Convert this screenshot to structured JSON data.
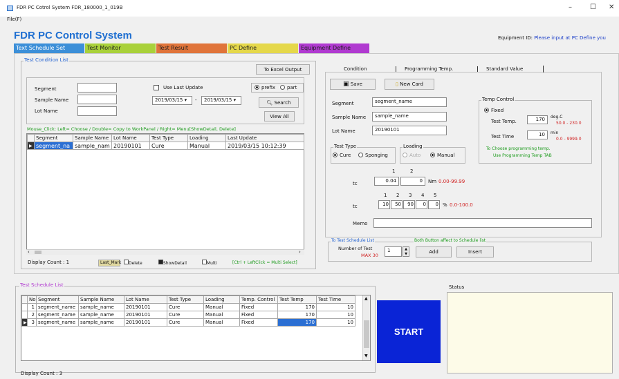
{
  "window": {
    "title": "FDR PC Cotrol System     FDR_180000_1_019B",
    "minimize": "–",
    "maximize": "☐",
    "close": "✕"
  },
  "menu": {
    "file": "File(F)"
  },
  "app": {
    "title": "FDR PC Control System"
  },
  "equipment": {
    "label": "Equipment ID:",
    "value": "Please input at PC Define you"
  },
  "top_tabs": [
    {
      "label": "Text Schedule Set",
      "color": "#3c8fd8"
    },
    {
      "label": "Test Monitor",
      "color": "#a9d13a"
    },
    {
      "label": "Test Result",
      "color": "#e0743a"
    },
    {
      "label": "PC Define",
      "color": "#e5d84a"
    },
    {
      "label": "Equipment Define",
      "color": "#b03ad0"
    }
  ],
  "condition_list": {
    "group_label": "Test Condition List",
    "excel_button": "To Excel Output",
    "segment_label": "Segment",
    "sample_label": "Sample Name",
    "lot_label": "Lot Name",
    "use_last_update": "Use Last Update",
    "date_from": "2019/03/15",
    "date_to": "2019/03/15",
    "date_sep": "-",
    "prefix_option": "prefix",
    "part_option": "part",
    "search_button": "Search",
    "view_all_button": "View All",
    "hint": "Mouse_Click: Left= Choose / Double= Copy to WorkPanel / Right= Menu[ShowDetail, Delete]",
    "columns": [
      "Segment",
      "Sample Name",
      "Lot Name",
      "Test Type",
      "Loading",
      "Last Update"
    ],
    "rows": [
      [
        "segment_na",
        "sample_nam",
        "20190101",
        "Cure",
        "Manual",
        "2019/03/15 10:12:39"
      ]
    ],
    "display_count": "Display Count : 1",
    "legend": {
      "last_mark": "Last_Mark",
      "delete": "Delete",
      "show_detail": "ShowDetail",
      "multi": "Multi",
      "ctrl_hint": "[Ctrl + LeftClick = Multi Select]"
    }
  },
  "condition": {
    "tabs": [
      "Condition",
      "Programming Temp.",
      "Standard Value"
    ],
    "save_button": "Save",
    "new_card_button": "New Card",
    "segment_label": "Segment",
    "segment_value": "segment_name",
    "sample_label": "Sample Name",
    "sample_value": "sample_name",
    "lot_label": "Lot Name",
    "lot_value": "20190101",
    "test_type_label": "Test Type",
    "cure_option": "Cure",
    "sponging_option": "Sponging",
    "loading_label": "Loading",
    "auto_option": "Auto",
    "manual_option": "Manual",
    "temp_control_label": "Temp Control",
    "fixed_option": "Fixed",
    "test_temp_label": "Test Temp.",
    "test_temp_value": "170",
    "test_temp_unit": "deg.C",
    "test_temp_range": "50.0 - 230.0",
    "test_time_label": "Test Time",
    "test_time_value": "10",
    "test_time_unit": "min",
    "test_time_range": "0.0 - 9999.0",
    "prog_note1": "To Choose programming temp.",
    "prog_note2": "Use  Programming Temp TAB",
    "tc_label": "tc",
    "tc_idx": [
      "1",
      "2"
    ],
    "tc_values": [
      "0.04",
      "0"
    ],
    "tc_unit": "Nm",
    "tc_range": "0.00-99.99",
    "tc2_label": "tc",
    "tc2_idx": [
      "1",
      "2",
      "3",
      "4",
      "5"
    ],
    "tc2_values": [
      "10",
      "50",
      "90",
      "0",
      "0"
    ],
    "tc2_unit": "%",
    "tc2_range": "0.0-100.0",
    "memo_label": "Memo"
  },
  "schedule_add": {
    "label": "To Test Schedule List",
    "note": "Both Button affect to Schedule list",
    "number_label": "Number of Test",
    "max_label": "MAX 30",
    "number_value": "1",
    "add_button": "Add",
    "insert_button": "Insert"
  },
  "schedule_list": {
    "group_label": "Test Schedule List",
    "columns": [
      "No.",
      "Segment",
      "Sample Name",
      "Lot Name",
      "Test Type",
      "Loading",
      "Temp. Control",
      "Test Temp",
      "Test Time"
    ],
    "rows": [
      [
        "1",
        "segment_name",
        "sample_name",
        "20190101",
        "Cure",
        "Manual",
        "Fixed",
        "170",
        "10"
      ],
      [
        "2",
        "segment_name",
        "sample_name",
        "20190101",
        "Cure",
        "Manual",
        "Fixed",
        "170",
        "10"
      ],
      [
        "3",
        "segment_name",
        "sample_name",
        "20190101",
        "Cure",
        "Manual",
        "Fixed",
        "170",
        "10"
      ]
    ],
    "display_count": "Display Count : 3"
  },
  "start_button": "START",
  "status": {
    "label": "Status"
  }
}
